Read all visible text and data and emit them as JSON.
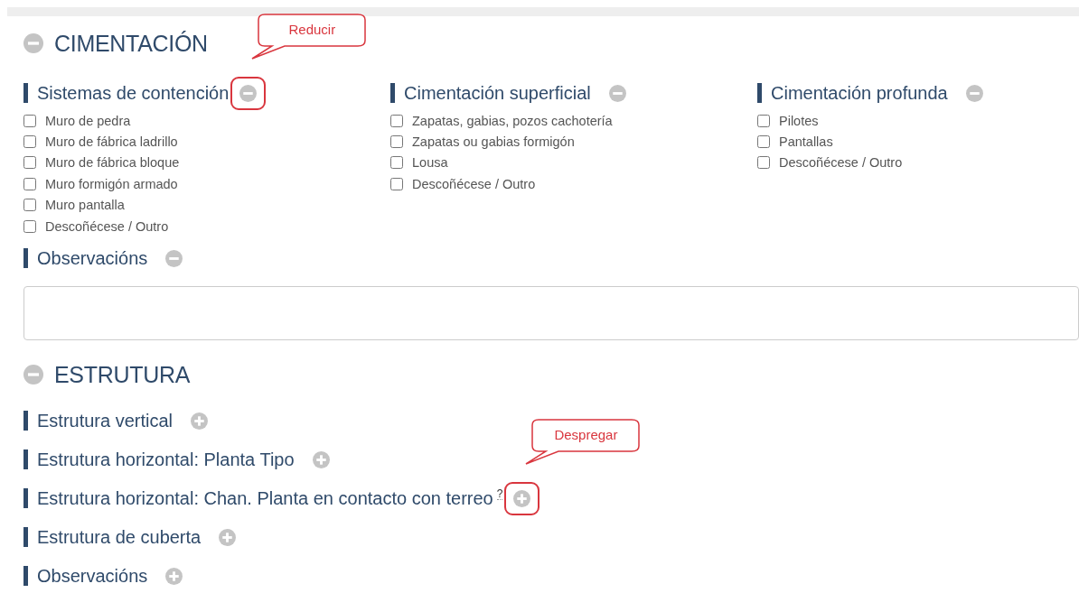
{
  "sections": [
    {
      "title": "CIMENTACIÓN",
      "expanded": true,
      "groups": [
        {
          "kind": "checklist",
          "title": "Sistemas de contención",
          "expanded": true,
          "highlighted": true,
          "callout": "Reducir",
          "options": [
            {
              "label": "Muro de pedra",
              "checked": false
            },
            {
              "label": "Muro de fábrica ladrillo",
              "checked": false
            },
            {
              "label": "Muro de fábrica bloque",
              "checked": false
            },
            {
              "label": "Muro formigón armado",
              "checked": false
            },
            {
              "label": "Muro pantalla",
              "checked": false
            },
            {
              "label": "Descoñécese / Outro",
              "checked": false
            }
          ]
        },
        {
          "kind": "checklist",
          "title": "Cimentación superficial",
          "expanded": true,
          "highlighted": false,
          "options": [
            {
              "label": "Zapatas, gabias, pozos cachotería",
              "checked": false
            },
            {
              "label": "Zapatas ou gabias formigón",
              "checked": false
            },
            {
              "label": "Lousa",
              "checked": false
            },
            {
              "label": "Descoñécese / Outro",
              "checked": false
            }
          ]
        },
        {
          "kind": "checklist",
          "title": "Cimentación profunda",
          "expanded": true,
          "highlighted": false,
          "options": [
            {
              "label": "Pilotes",
              "checked": false
            },
            {
              "label": "Pantallas",
              "checked": false
            },
            {
              "label": "Descoñécese / Outro",
              "checked": false
            }
          ]
        },
        {
          "kind": "text",
          "title": "Observacións",
          "expanded": true,
          "highlighted": false
        }
      ]
    },
    {
      "title": "ESTRUTURA",
      "expanded": true,
      "groups": [
        {
          "kind": "checklist",
          "title": "Estrutura vertical",
          "expanded": false,
          "highlighted": false
        },
        {
          "kind": "checklist",
          "title": "Estrutura horizontal: Planta Tipo",
          "expanded": false,
          "highlighted": false
        },
        {
          "kind": "checklist",
          "title": "Estrutura horizontal: Chan. Planta en contacto con terreo",
          "help": "?",
          "expanded": false,
          "highlighted": true,
          "callout": "Despregar"
        },
        {
          "kind": "checklist",
          "title": "Estrutura de cuberta",
          "expanded": false,
          "highlighted": false
        },
        {
          "kind": "text",
          "title": "Observacións",
          "expanded": false,
          "highlighted": false
        }
      ]
    }
  ]
}
